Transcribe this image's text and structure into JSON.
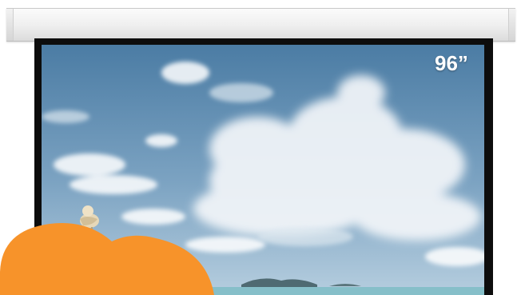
{
  "screen": {
    "size_label": "96”"
  },
  "colors": {
    "housing": "#eeeeee",
    "frame": "#0d0d0d",
    "sky_top": "#4e7fa6",
    "sky_bottom": "#a9c4d7",
    "sea": "#7fb9c6",
    "overlay_shape": "#f7932a"
  },
  "icons": {
    "bird": "seagull-figure",
    "overlay": "orange-cloud-shape"
  }
}
